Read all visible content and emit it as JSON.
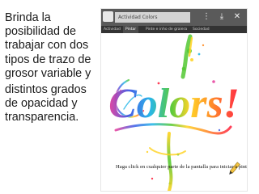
{
  "slide": {
    "paragraphs": [
      "Brinda la posibilidad de trabajar con dos tipos de trazo de grosor variable y",
      "distintos grados de opacidad y transparencia."
    ]
  },
  "app": {
    "activity_name": "Actividad Colors",
    "controls": {
      "more_glyph": "⋮",
      "save_glyph": "⤓",
      "close_glyph": "✕"
    },
    "tabs": [
      {
        "label": "Actividad",
        "active": false
      },
      {
        "label": "Pintar",
        "active": true
      },
      {
        "label": "Pinte e inho de graiera",
        "active": false
      },
      {
        "label": "Sociedad",
        "active": false
      }
    ]
  },
  "canvas": {
    "painted_word": "Colors!",
    "caption": "Haga click en cualquier parte de la pantalla para iniciar a pintar"
  },
  "colors": {
    "titlebar": "#5a5a5a",
    "toolbar": "#333333",
    "paint": [
      "#ff1e3c",
      "#ff8a1e",
      "#ffd21e",
      "#52c832",
      "#1eb4e6",
      "#3c5ae6",
      "#9b3ce6",
      "#e63c9b"
    ]
  }
}
